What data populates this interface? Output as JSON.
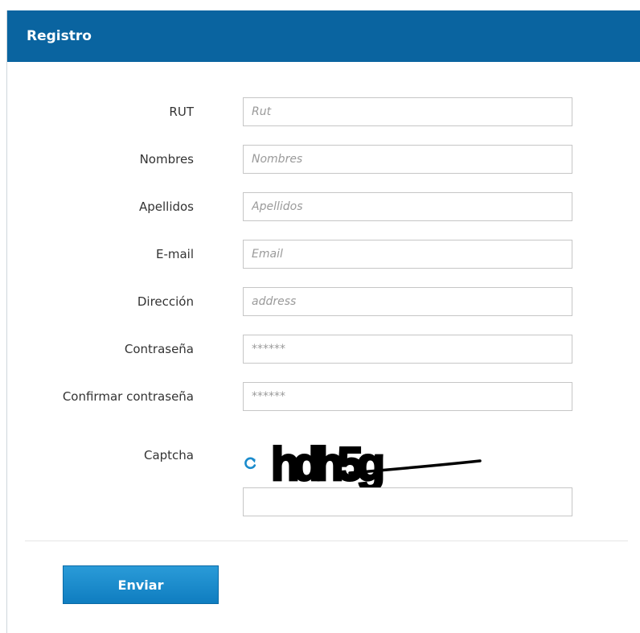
{
  "form": {
    "title": "Registro",
    "fields": [
      {
        "label": "RUT",
        "placeholder": "Rut"
      },
      {
        "label": "Nombres",
        "placeholder": "Nombres"
      },
      {
        "label": "Apellidos",
        "placeholder": "Apellidos"
      },
      {
        "label": "E-mail",
        "placeholder": "Email"
      },
      {
        "label": "Dirección",
        "placeholder": "address"
      },
      {
        "label": "Contraseña",
        "placeholder": "******"
      },
      {
        "label": "Confirmar contraseña",
        "placeholder": "******"
      }
    ],
    "captcha": {
      "label": "Captcha",
      "text": "hdh5g",
      "value": ""
    },
    "submit_label": "Enviar"
  },
  "colors": {
    "header": "#0a64a0",
    "button": "#1a8bcc",
    "refresh_icon": "#1a8bcc"
  }
}
